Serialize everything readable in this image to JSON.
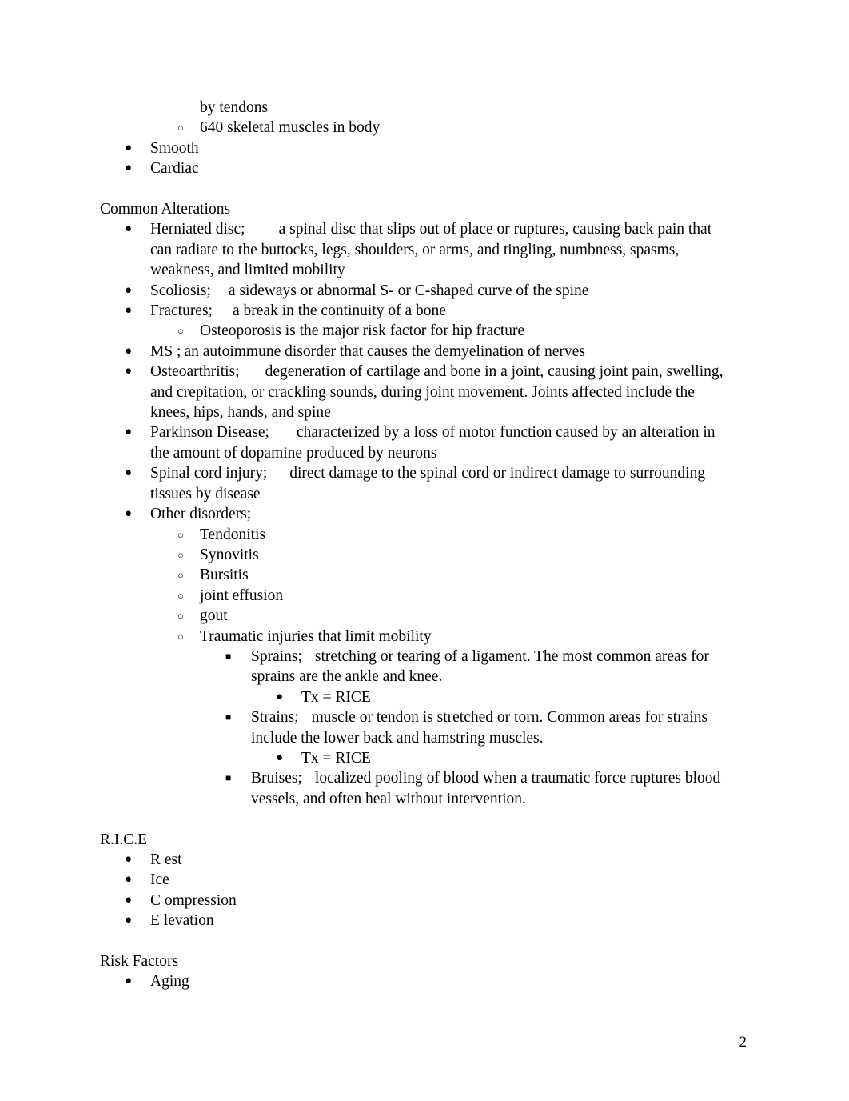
{
  "document": {
    "page_number": "2",
    "bullets": {
      "disc": "●",
      "circle": "○",
      "square": "■"
    }
  },
  "top_fragment": {
    "continuation_line": "by tendons",
    "skeletal_count_item": "640 skeletal muscles in body",
    "muscle_types": [
      "Smooth",
      "Cardiac"
    ]
  },
  "common_alterations": {
    "heading": "Common Alterations",
    "items": [
      {
        "term": "Herniated disc;",
        "definition": "a spinal disc that slips out of place or ruptures, causing back pain that can radiate to the buttocks, legs, shoulders, or arms, and tingling, numbness, spasms, weakness, and limited mobility"
      },
      {
        "term": "Scoliosis;",
        "definition": "a sideways or abnormal S- or C-shaped curve of the spine"
      },
      {
        "term": "Fractures;",
        "definition": "a break in the continuity of a bone",
        "sub_items": [
          "Osteoporosis is the major risk factor for hip fracture"
        ]
      },
      {
        "term": "MS ;",
        "definition": "an autoimmune disorder that causes the demyelination of nerves",
        "inline": true
      },
      {
        "term": "Osteoarthritis;",
        "definition": "degeneration of cartilage and bone in a joint, causing joint pain, swelling, and crepitation, or crackling sounds, during joint movement. Joints affected include the knees, hips, hands, and spine"
      },
      {
        "term": "Parkinson Disease;",
        "definition": "characterized by a loss of motor function caused by an alteration in the amount of dopamine produced by neurons"
      },
      {
        "term": "Spinal cord injury;",
        "definition": "direct damage to the spinal cord or indirect damage to surrounding tissues by disease"
      }
    ],
    "other_disorders": {
      "term": "Other disorders;",
      "sub_items": [
        "Tendonitis",
        "Synovitis",
        "Bursitis",
        "joint effusion",
        "gout",
        "Traumatic injuries that limit mobility"
      ],
      "traumatic_injuries": [
        {
          "term": "Sprains;",
          "definition": "stretching or tearing of a ligament. The most common areas for sprains are the ankle and knee.",
          "treatment": "Tx = RICE"
        },
        {
          "term": "Strains;",
          "definition": "muscle or tendon is stretched or torn. Common areas for strains include the lower back and hamstring muscles.",
          "treatment": "Tx = RICE"
        },
        {
          "term": "Bruises;",
          "definition": "localized pooling of blood when a traumatic force ruptures blood vessels, and often heal without intervention.",
          "treatment": null
        }
      ]
    }
  },
  "rice": {
    "heading": "R.I.C.E",
    "items": [
      "R est",
      "Ice",
      "C ompression",
      "E levation"
    ]
  },
  "risk_factors": {
    "heading": "Risk Factors",
    "items": [
      "Aging"
    ]
  }
}
